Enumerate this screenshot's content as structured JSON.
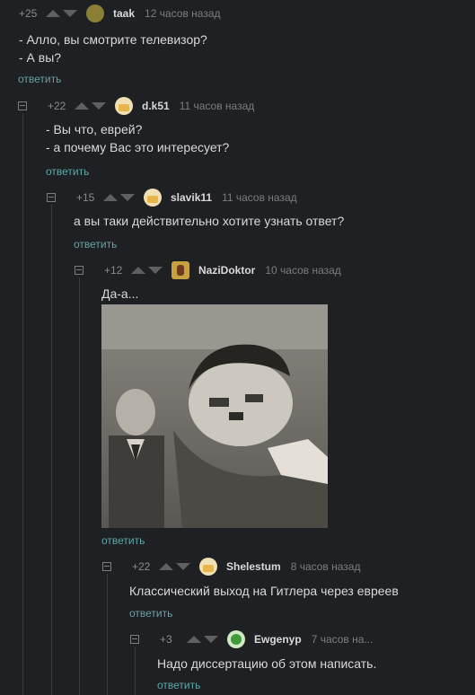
{
  "reply_label": "ответить",
  "comments": [
    {
      "rating": "+25",
      "username": "taak",
      "time": "12 часов назад",
      "lines": [
        "- Алло, вы смотрите телевизор?",
        "- А вы?"
      ]
    },
    {
      "rating": "+22",
      "username": "d.k51",
      "time": "11 часов назад",
      "lines": [
        "- Вы что, еврей?",
        "- а почему Вас это интересует?"
      ]
    },
    {
      "rating": "+15",
      "username": "slavik11",
      "time": "11 часов назад",
      "lines": [
        "а вы таки действительно хотите узнать ответ?"
      ]
    },
    {
      "rating": "+12",
      "username": "NaziDoktor",
      "time": "10 часов назад",
      "lines": [
        "Да-а..."
      ]
    },
    {
      "rating": "+22",
      "username": "Shelestum",
      "time": "8 часов назад",
      "lines": [
        "Классический выход на Гитлера через евреев"
      ]
    },
    {
      "rating": "+3",
      "username": "Ewgenyp",
      "time": "7 часов на...",
      "lines": [
        "Надо диссертацию об этом написать."
      ]
    }
  ]
}
